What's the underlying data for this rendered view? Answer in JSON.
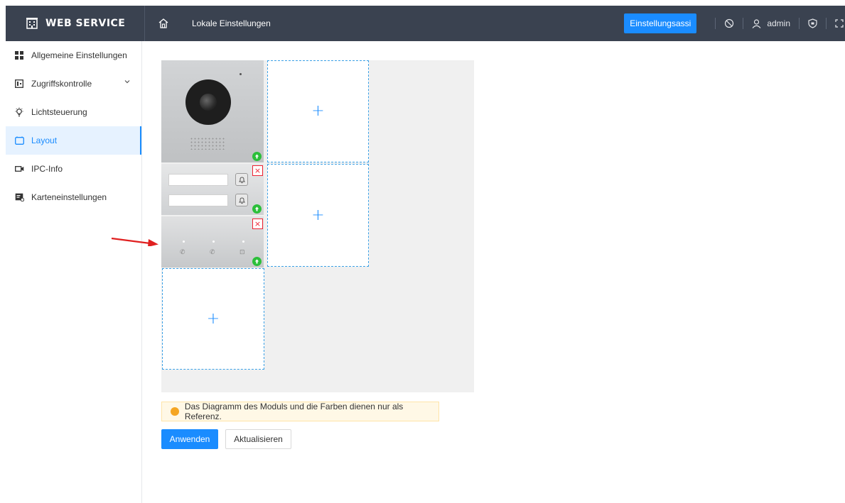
{
  "header": {
    "brand": "WEB SERVICE",
    "page_title": "Lokale Einstellungen",
    "wizard_button": "Einstellungsassi",
    "username": "admin",
    "bg_color": "#3a4250",
    "accent": "#1a8cff"
  },
  "sidebar": {
    "items": [
      {
        "label": "Allgemeine Einstellungen",
        "icon": "grid-icon"
      },
      {
        "label": "Zugriffskontrolle",
        "icon": "door-icon",
        "expandable": true
      },
      {
        "label": "Lichtsteuerung",
        "icon": "bulb-icon"
      },
      {
        "label": "Layout",
        "icon": "layout-icon",
        "active": true
      },
      {
        "label": "IPC-Info",
        "icon": "camera-icon"
      },
      {
        "label": "Karteneinstellungen",
        "icon": "card-icon"
      }
    ]
  },
  "layout_editor": {
    "add_symbol": "+",
    "remove_symbol": "×"
  },
  "notice": {
    "text": "Das Diagramm des Moduls und die Farben dienen nur als Referenz."
  },
  "actions": {
    "apply": "Anwenden",
    "refresh": "Aktualisieren"
  }
}
